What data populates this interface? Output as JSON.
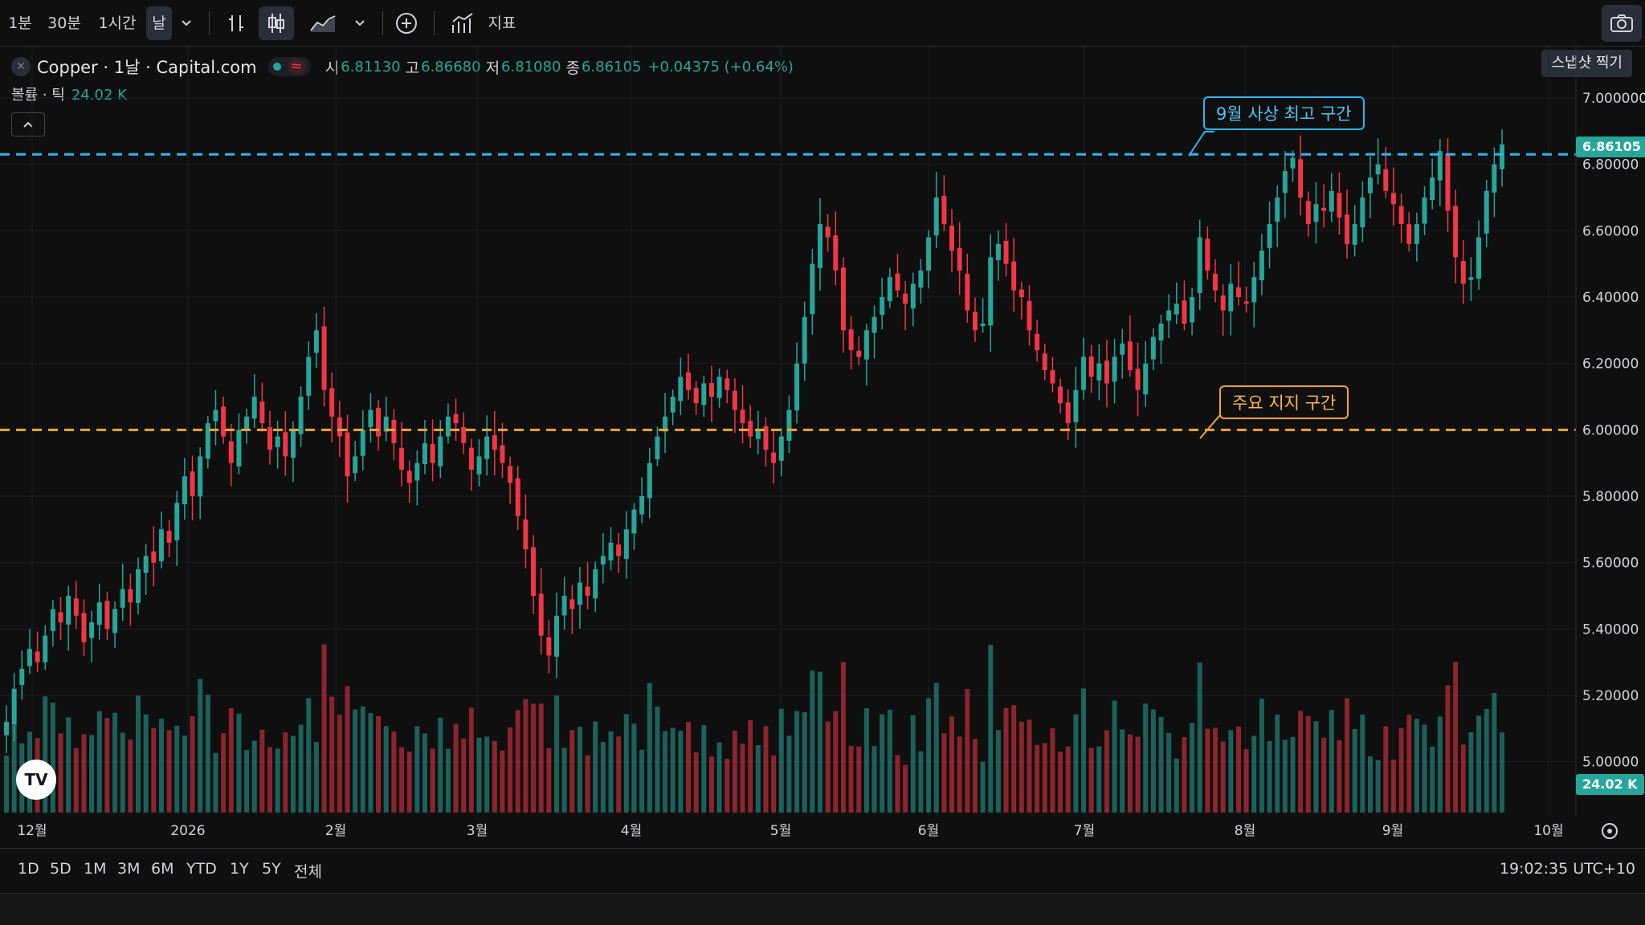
{
  "toolbar": {
    "intervals": [
      "1분",
      "30분",
      "1시간",
      "날"
    ],
    "active_interval": "날",
    "indicators_label": "지표",
    "snapshot_tooltip": "스냅샷 찍기"
  },
  "legend": {
    "symbol_title": "Copper · 1날 · Capital.com",
    "open_key": "시",
    "open_value": "6.81130",
    "high_key": "고",
    "high_value": "6.86680",
    "low_key": "저",
    "low_value": "6.81080",
    "close_key": "종",
    "close_value": "6.86105",
    "change": "+0.04375 (+0.64%)",
    "volume_label": "볼륨 · 틱",
    "volume_value": "24.02 K"
  },
  "annotations": {
    "resistance_label": "9월 사상 최고 구간",
    "support_label": "주요 지지 구간"
  },
  "price_scale": {
    "ticks": [
      "7.000000",
      "6.80000",
      "6.60000",
      "6.40000",
      "6.20000",
      "6.00000",
      "5.80000",
      "5.60000",
      "5.40000",
      "5.20000",
      "5.00000"
    ],
    "last_price_label": "6.86105",
    "volume_label": "24.02 K"
  },
  "time_scale": {
    "labels": [
      "12월",
      "2026",
      "2월",
      "3월",
      "4월",
      "5월",
      "6월",
      "7월",
      "8월",
      "9월",
      "10월"
    ]
  },
  "bottom": {
    "ranges": [
      "1D",
      "5D",
      "1M",
      "3M",
      "6M",
      "YTD",
      "1Y",
      "5Y",
      "전체"
    ],
    "clock": "19:02:35 UTC+10"
  },
  "colors": {
    "up": "#26a69a",
    "down": "#f23645",
    "resistance_line": "#29b6f6",
    "support_line": "#f5a623",
    "background": "#0f0f0f"
  },
  "chart_data": {
    "type": "candlestick",
    "ylim": [
      5.0,
      7.0
    ],
    "resistance_level": 6.83,
    "support_level": 6.0,
    "last_price": 6.86105,
    "close_series": [
      5.12,
      5.22,
      5.28,
      5.34,
      5.3,
      5.38,
      5.46,
      5.42,
      5.5,
      5.44,
      5.36,
      5.42,
      5.48,
      5.4,
      5.46,
      5.52,
      5.48,
      5.58,
      5.62,
      5.6,
      5.7,
      5.66,
      5.78,
      5.86,
      5.8,
      5.92,
      6.02,
      6.06,
      5.98,
      5.9,
      6.0,
      6.04,
      6.1,
      6.02,
      5.94,
      5.98,
      5.92,
      6.0,
      6.1,
      6.22,
      6.3,
      6.12,
      6.04,
      5.98,
      5.86,
      5.92,
      6.0,
      6.06,
      5.98,
      6.04,
      5.96,
      5.88,
      5.84,
      5.9,
      5.96,
      5.9,
      5.98,
      6.04,
      6.02,
      5.96,
      5.88,
      5.92,
      5.98,
      5.94,
      5.9,
      5.84,
      5.74,
      5.64,
      5.5,
      5.38,
      5.32,
      5.44,
      5.5,
      5.46,
      5.54,
      5.5,
      5.58,
      5.62,
      5.66,
      5.62,
      5.7,
      5.76,
      5.8,
      5.9,
      5.98,
      6.04,
      6.1,
      6.16,
      6.12,
      6.08,
      6.14,
      6.1,
      6.16,
      6.12,
      6.06,
      6.02,
      5.98,
      6.0,
      5.94,
      5.9,
      5.98,
      6.06,
      6.2,
      6.34,
      6.5,
      6.62,
      6.58,
      6.48,
      6.3,
      6.24,
      6.22,
      6.3,
      6.34,
      6.4,
      6.46,
      6.42,
      6.38,
      6.44,
      6.48,
      6.58,
      6.7,
      6.62,
      6.54,
      6.48,
      6.36,
      6.3,
      6.32,
      6.52,
      6.56,
      6.5,
      6.42,
      6.4,
      6.3,
      6.24,
      6.18,
      6.14,
      6.08,
      6.02,
      6.12,
      6.22,
      6.16,
      6.2,
      6.14,
      6.22,
      6.26,
      6.18,
      6.12,
      6.2,
      6.28,
      6.32,
      6.36,
      6.38,
      6.32,
      6.4,
      6.58,
      6.48,
      6.42,
      6.36,
      6.44,
      6.4,
      6.38,
      6.46,
      6.54,
      6.62,
      6.7,
      6.78,
      6.82,
      6.7,
      6.62,
      6.68,
      6.66,
      6.72,
      6.64,
      6.56,
      6.62,
      6.7,
      6.76,
      6.8,
      6.72,
      6.68,
      6.62,
      6.56,
      6.62,
      6.7,
      6.76,
      6.84,
      6.66,
      6.52,
      6.44,
      6.46,
      6.58,
      6.72,
      6.8,
      6.86
    ]
  }
}
